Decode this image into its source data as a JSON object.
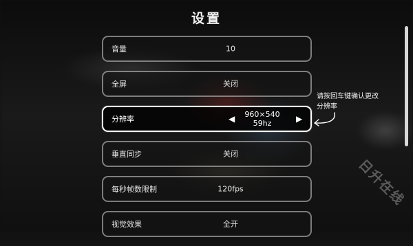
{
  "title": "设置",
  "settings": [
    {
      "label": "音量",
      "value": "10"
    },
    {
      "label": "全屏",
      "value": "关闭"
    },
    {
      "label": "分辨率",
      "value_line1": "960×540",
      "value_line2": "59hz"
    },
    {
      "label": "垂直同步",
      "value": "关闭"
    },
    {
      "label": "每秒帧数限制",
      "value": "120fps"
    },
    {
      "label": "视觉效果",
      "value": "全开"
    }
  ],
  "arrows": {
    "left": "◀",
    "right": "▶"
  },
  "hint": {
    "line1": "请按回车键确认更改",
    "line2": "分辨率"
  },
  "watermark": "日升在线"
}
